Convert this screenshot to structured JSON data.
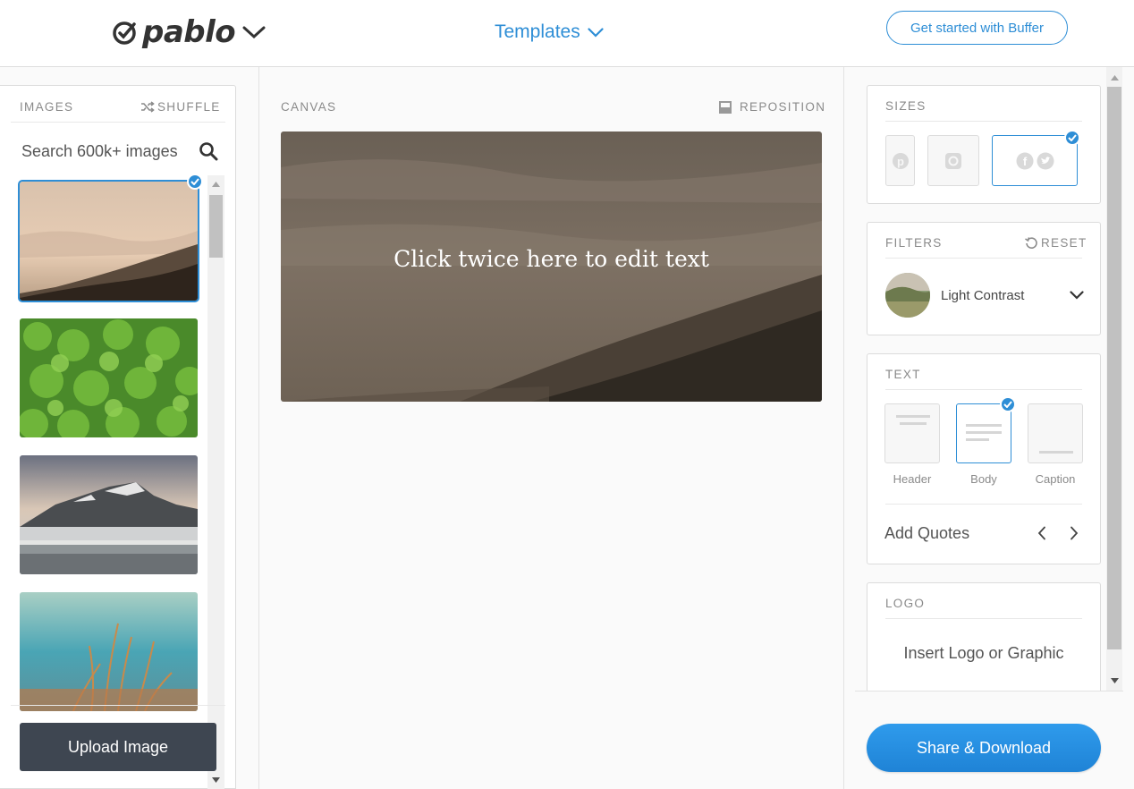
{
  "header": {
    "logo_text": "pablo",
    "templates_label": "Templates",
    "cta_label": "Get started with Buffer"
  },
  "images_panel": {
    "heading": "IMAGES",
    "shuffle_label": "SHUFFLE",
    "search_placeholder": "Search 600k+ images",
    "upload_label": "Upload Image",
    "thumbnails": [
      {
        "subject": "misty mountain sunrise",
        "selected": true
      },
      {
        "subject": "green clover leaves",
        "selected": false
      },
      {
        "subject": "snowy mountain over misty lake",
        "selected": false
      },
      {
        "subject": "grass against teal sky",
        "selected": false
      }
    ]
  },
  "canvas": {
    "heading": "CANVAS",
    "reposition_label": "REPOSITION",
    "overlay_text": "Click twice here to edit text"
  },
  "sizes": {
    "heading": "SIZES",
    "options": [
      {
        "name": "pinterest",
        "selected": false
      },
      {
        "name": "instagram",
        "selected": false
      },
      {
        "name": "facebook-twitter",
        "selected": true
      }
    ]
  },
  "filters": {
    "heading": "FILTERS",
    "reset_label": "RESET",
    "selected": "Light Contrast"
  },
  "text_panel": {
    "heading": "TEXT",
    "styles": [
      {
        "label": "Header",
        "selected": false
      },
      {
        "label": "Body",
        "selected": true
      },
      {
        "label": "Caption",
        "selected": false
      }
    ],
    "add_quotes_label": "Add Quotes"
  },
  "logo_panel": {
    "heading": "LOGO",
    "insert_label": "Insert Logo or Graphic"
  },
  "share_label": "Share & Download",
  "colors": {
    "accent": "#2e8ed6",
    "upload_button": "#3e4651",
    "share_button": "#2a93e6"
  }
}
